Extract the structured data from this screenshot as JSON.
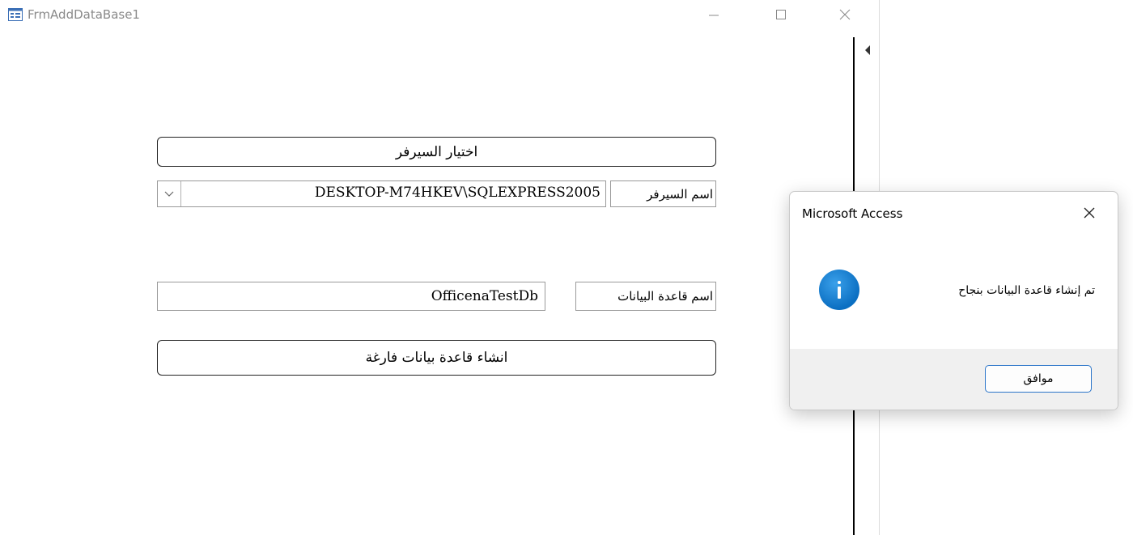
{
  "window": {
    "title": "FrmAddDataBase1",
    "icon": "form-icon"
  },
  "form": {
    "select_server_button": "اختيار السيرفر",
    "server_label": "اسم السيرفر",
    "server_value": "DESKTOP-M74HKEV\\SQLEXPRESS2005",
    "db_label": "اسم قاعدة البيانات",
    "db_value": "OfficenaTestDb",
    "create_db_button": "انشاء قاعدة بيانات فارغة"
  },
  "dialog": {
    "title": "Microsoft Access",
    "message": "تم إنشاء قاعدة البيانات بنجاح",
    "ok_label": "موافق",
    "icon": "info-icon",
    "accent_color": "#0b6fc2"
  }
}
